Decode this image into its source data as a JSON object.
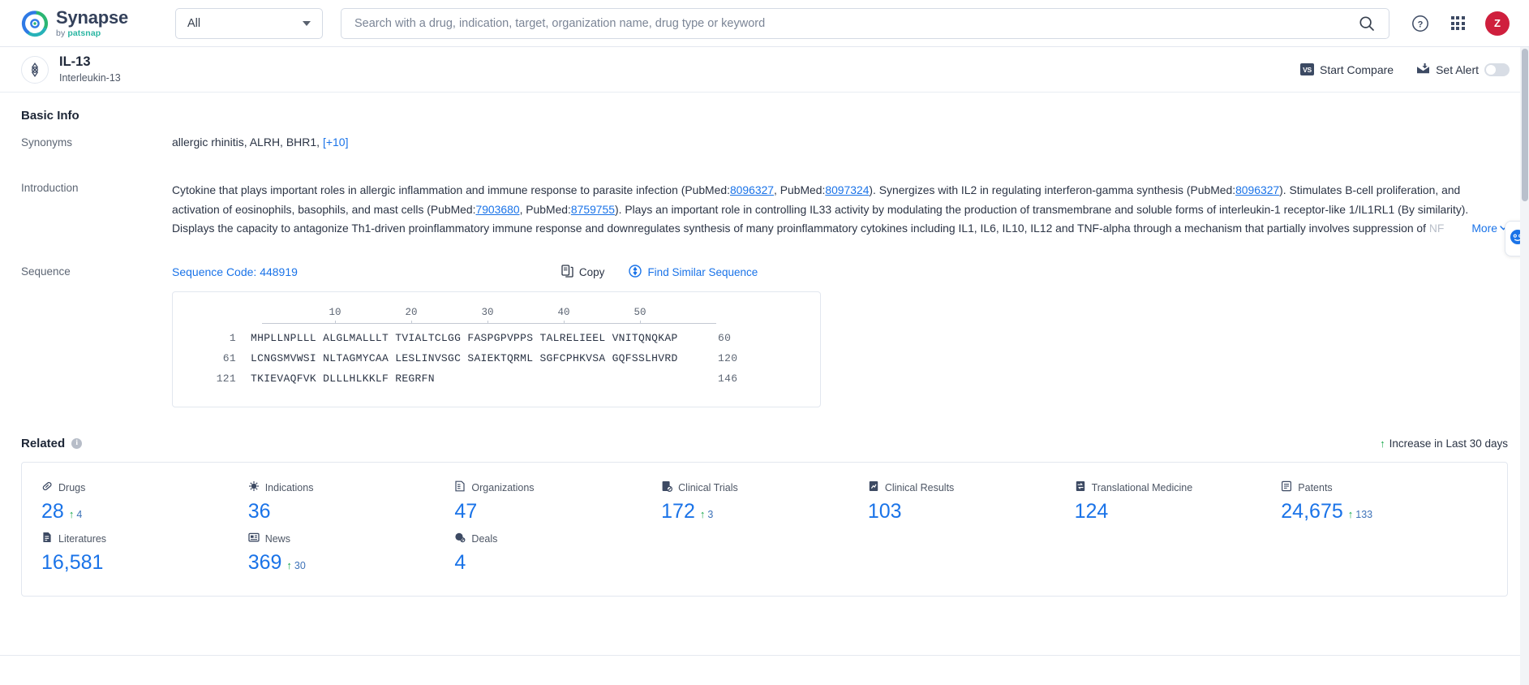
{
  "header": {
    "logo_name": "Synapse",
    "logo_by": "by ",
    "logo_brand": "patsnap",
    "scope_value": "All",
    "search_placeholder": "Search with a drug, indication, target, organization name, drug type or keyword",
    "search_value": "",
    "help_icon": "help-circle-icon",
    "apps_icon": "apps-grid-icon",
    "avatar_initial": "Z",
    "avatar_color": "#cf1f3d"
  },
  "entity": {
    "icon": "target-icon",
    "title": "IL-13",
    "subtitle": "Interleukin-13",
    "compare_label": "Start Compare",
    "compare_badge": "VS",
    "alert_label": "Set Alert",
    "alert_enabled": false
  },
  "basic_info": {
    "section_title": "Basic Info",
    "synonyms_label": "Synonyms",
    "synonyms_value": "allergic rhinitis,  ALRH,  BHR1, ",
    "synonyms_more": "[+10]",
    "introduction_label": "Introduction",
    "introduction": {
      "p1": "Cytokine that plays important roles in allergic inflammation and immune response to parasite infection (PubMed:",
      "ref1": "8096327",
      "p2": ", PubMed:",
      "ref2": "8097324",
      "p3": "). Synergizes with IL2 in regulating interferon-gamma synthesis (PubMed:",
      "ref3": "8096327",
      "p4": "). Stimulates B-cell proliferation, and activation of eosinophils, basophils, and mast cells (PubMed:",
      "ref4": "7903680",
      "p5": ", PubMed:",
      "ref5": "8759755",
      "p6": "). Plays an important role in controlling IL33 activity by modulating the production of transmembrane and soluble forms of interleukin-1 receptor-like 1/IL1RL1 (By similarity). Displays the capacity to antagonize Th1-driven proinflammatory immune response and downregulates synthesis of many proinflammatory cytokines including IL1, IL6, IL10, IL12 and TNF-alpha through a mechanism that partially involves suppression of ",
      "p7_faded": "NF"
    },
    "more_label": "More",
    "more_icon": "chevron-down-icon"
  },
  "sequence": {
    "label": "Sequence",
    "code_label": "Sequence Code: 448919",
    "copy_label": "Copy",
    "copy_icon": "copy-icon",
    "find_label": "Find Similar Sequence",
    "find_icon": "find-similar-icon",
    "ruler_ticks": [
      "10",
      "20",
      "30",
      "40",
      "50"
    ],
    "lines": [
      {
        "start": "1",
        "chunks": "MHPLLNPLLL ALGLMALLLT TVIALTCLGG FASPGPVPPS TALRELIEEL VNITQNQKAP",
        "end": "60"
      },
      {
        "start": "61",
        "chunks": "LCNGSMVWSI NLTAGMYCAA LESLINVSGC SAIEKTQRML SGFCPHKVSA GQFSSLHVRD",
        "end": "120"
      },
      {
        "start": "121",
        "chunks": "TKIEVAQFVK DLLLHLKKLF REGRFN",
        "end": "146"
      }
    ]
  },
  "related": {
    "title": "Related",
    "info_icon": "info-icon",
    "increase_note": "Increase in Last 30 days",
    "increase_icon": "arrow-up-icon",
    "stats": [
      {
        "label": "Drugs",
        "icon": "pill-icon",
        "value": "28",
        "delta": "4"
      },
      {
        "label": "Indications",
        "icon": "virus-icon",
        "value": "36",
        "delta": ""
      },
      {
        "label": "Organizations",
        "icon": "building-icon",
        "value": "47",
        "delta": ""
      },
      {
        "label": "Clinical Trials",
        "icon": "clinical-trial-icon",
        "value": "172",
        "delta": "3"
      },
      {
        "label": "Clinical Results",
        "icon": "clinical-result-icon",
        "value": "103",
        "delta": ""
      },
      {
        "label": "Translational Medicine",
        "icon": "translational-icon",
        "value": "124",
        "delta": ""
      },
      {
        "label": "Patents",
        "icon": "patent-icon",
        "value": "24,675",
        "delta": "133"
      },
      {
        "label": "Literatures",
        "icon": "literature-icon",
        "value": "16,581",
        "delta": ""
      },
      {
        "label": "News",
        "icon": "news-icon",
        "value": "369",
        "delta": "30"
      },
      {
        "label": "Deals",
        "icon": "deals-icon",
        "value": "4",
        "delta": ""
      }
    ]
  },
  "chat": {
    "icon": "chat-bot-icon"
  }
}
